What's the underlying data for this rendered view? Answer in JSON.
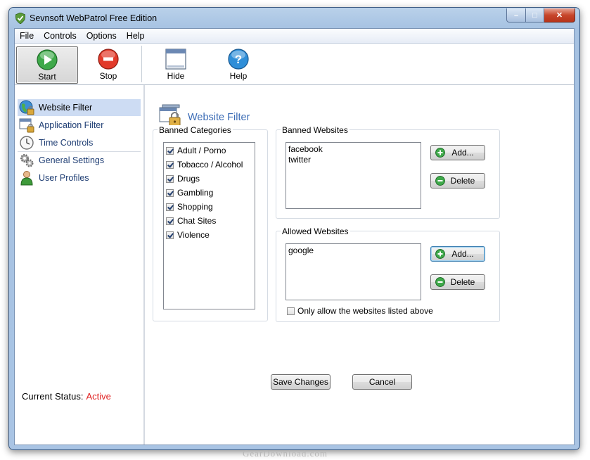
{
  "window": {
    "title": "Sevnsoft WebPatrol Free Edition",
    "controls": {
      "minimize": "–",
      "maximize": "□",
      "close": "✕"
    }
  },
  "menu": [
    "File",
    "Controls",
    "Options",
    "Help"
  ],
  "toolbar": {
    "start": "Start",
    "stop": "Stop",
    "hide": "Hide",
    "help": "Help"
  },
  "sidebar": {
    "items": [
      {
        "label": "Website Filter",
        "icon": "globe-lock-icon",
        "active": true
      },
      {
        "label": "Application Filter",
        "icon": "app-lock-icon",
        "active": false
      },
      {
        "label": "Time Controls",
        "icon": "clock-icon",
        "active": false
      },
      {
        "label": "General Settings",
        "icon": "gears-icon",
        "active": false
      },
      {
        "label": "User Profiles",
        "icon": "user-icon",
        "active": false
      }
    ],
    "status_label": "Current Status:",
    "status_value": "Active"
  },
  "main": {
    "title": "Website Filter",
    "banned_categories": {
      "title": "Banned Categories",
      "items": [
        {
          "label": "Adult / Porno",
          "checked": true
        },
        {
          "label": "Tobacco / Alcohol",
          "checked": true
        },
        {
          "label": "Drugs",
          "checked": true
        },
        {
          "label": "Gambling",
          "checked": true
        },
        {
          "label": "Shopping",
          "checked": true
        },
        {
          "label": "Chat Sites",
          "checked": true
        },
        {
          "label": "Violence",
          "checked": true
        }
      ]
    },
    "banned_websites": {
      "title": "Banned Websites",
      "items": [
        "facebook",
        "twitter"
      ],
      "add": "Add...",
      "delete": "Delete"
    },
    "allowed_websites": {
      "title": "Allowed Websites",
      "items": [
        "google"
      ],
      "add": "Add...",
      "delete": "Delete",
      "only_allow_label": "Only allow the websites listed above",
      "only_allow_checked": false
    },
    "save": "Save Changes",
    "cancel": "Cancel"
  },
  "watermark": "GearDownload.com",
  "colors": {
    "accent_title": "#3a6bb5",
    "status_active": "#e02020",
    "sidebar_active_bg": "#cddcf3",
    "sidebar_text": "#1e3d73"
  }
}
